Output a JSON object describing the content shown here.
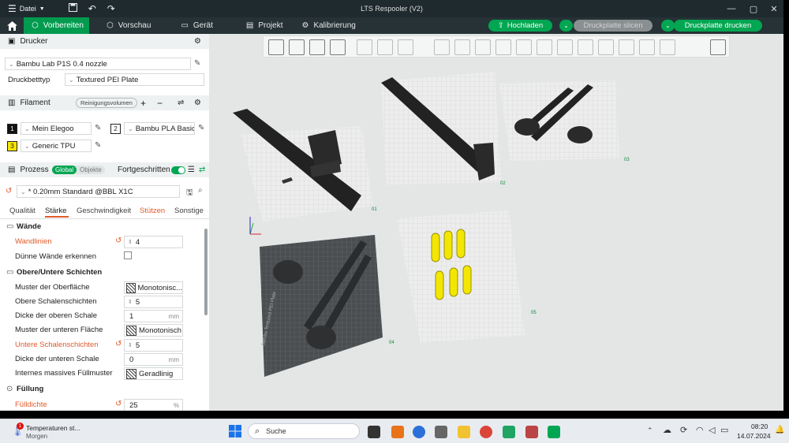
{
  "window": {
    "title": "LTS Respooler (V2)",
    "file_menu": "Datei"
  },
  "tabs": [
    {
      "label": "Vorbereiten",
      "active": true
    },
    {
      "label": "Vorschau"
    },
    {
      "label": "Gerät"
    },
    {
      "label": "Projekt"
    },
    {
      "label": "Kalibrierung"
    }
  ],
  "actions": {
    "upload": "Hochladen",
    "slice": "Druckplatte slicen",
    "print": "Druckplatte drucken"
  },
  "printer": {
    "section": "Drucker",
    "model": "Bambu Lab P1S 0.4 nozzle",
    "bed_label": "Druckbetttyp",
    "bed_value": "Textured PEI Plate"
  },
  "filament": {
    "section": "Filament",
    "purge": "Reinigungsvolumen",
    "items": [
      {
        "num": "1",
        "name": "Mein Elegoo",
        "color": "#111111"
      },
      {
        "num": "2",
        "name": "Bambu PLA Basic",
        "color": "#ffffff"
      },
      {
        "num": "3",
        "name": "Generic TPU",
        "color": "#f5e400"
      }
    ]
  },
  "process": {
    "section": "Prozess",
    "toggle_global": "Global",
    "toggle_objects": "Objekte",
    "advanced": "Fortgeschritten",
    "preset": "* 0.20mm Standard @BBL X1C",
    "subtabs": [
      "Qualität",
      "Stärke",
      "Geschwindigkeit",
      "Stützen",
      "Sonstige"
    ]
  },
  "settings": {
    "walls_section": "Wände",
    "wall_loops_label": "Wandlinien",
    "wall_loops_value": "4",
    "detect_thin_label": "Dünne Wände erkennen",
    "shells_section": "Obere/Untere Schichten",
    "top_pattern_label": "Muster der Oberfläche",
    "top_pattern_value": "Monotonisc...",
    "top_shell_layers_label": "Obere Schalenschichten",
    "top_shell_layers_value": "5",
    "top_shell_thickness_label": "Dicke der oberen Schale",
    "top_shell_thickness_value": "1",
    "bottom_pattern_label": "Muster der unteren Fläche",
    "bottom_pattern_value": "Monotonisch",
    "bottom_shell_layers_label": "Untere Schalenschichten",
    "bottom_shell_layers_value": "5",
    "bottom_shell_thickness_label": "Dicke der unteren Schale",
    "bottom_shell_thickness_value": "0",
    "internal_solid_label": "Internes massives Füllmuster",
    "internal_solid_value": "Geradlinig",
    "infill_section": "Füllung",
    "infill_density_label": "Fülldichte",
    "infill_density_value": "25",
    "unit_mm": "mm",
    "unit_pct": "%"
  },
  "plates": [
    {
      "label": "01"
    },
    {
      "label": "02"
    },
    {
      "label": "03"
    },
    {
      "label": "04"
    },
    {
      "label": "05"
    }
  ],
  "plate_text": "Bambu Textured PEI Plate",
  "taskbar": {
    "weather_title": "Temperaturen st...",
    "weather_sub": "Morgen",
    "weather_badge": "1",
    "search": "Suche",
    "time": "08:20",
    "date": "14.07.2024"
  },
  "colors": {
    "accent": "#00a651",
    "orange": "#e05a2a",
    "titlebar": "#1f2a2e"
  }
}
